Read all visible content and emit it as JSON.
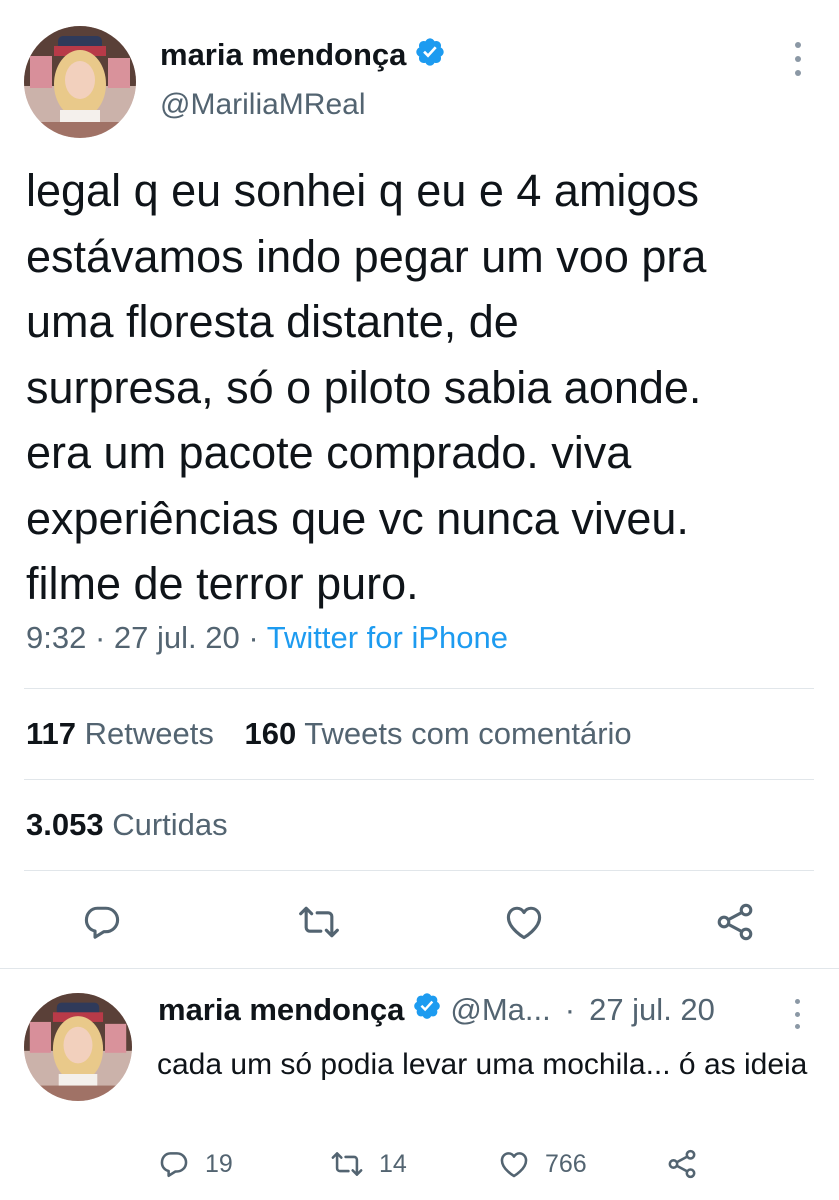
{
  "main_tweet": {
    "author_name": "maria mendonça",
    "handle": "@MariliaMReal",
    "verified_icon": "verified-badge-icon",
    "text": "legal q eu sonhei q eu e 4 amigos\nestávamos indo pegar um voo pra\numa floresta distante, de\nsurpresa, só o piloto sabia aonde.\nera um pacote comprado. viva\nexperiências que vc nunca viveu.\nfilme de terror puro.",
    "time": "9:32",
    "separator": "·",
    "date": "27 jul. 20",
    "source": "Twitter for iPhone",
    "retweets_count": "117",
    "retweets_label": "Retweets",
    "quotes_count": "160",
    "quotes_label": "Tweets com comentário",
    "likes_count": "3.053",
    "likes_label": "Curtidas",
    "actions": [
      "reply-icon",
      "retweet-icon",
      "like-icon",
      "share-icon"
    ]
  },
  "reply_tweet": {
    "author_name": "maria mendonça",
    "handle": "@Ma...",
    "separator": "·",
    "date": "27 jul. 20",
    "text": "cada um só podia levar uma mochila... ó as ideia",
    "reply_count": "19",
    "retweet_count": "14",
    "like_count": "766"
  },
  "colors": {
    "text_primary": "#0f1419",
    "text_secondary": "#536471",
    "link_blue": "#1d9bf0",
    "divider": "#e1e6ea",
    "icon_gray": "#536471"
  }
}
